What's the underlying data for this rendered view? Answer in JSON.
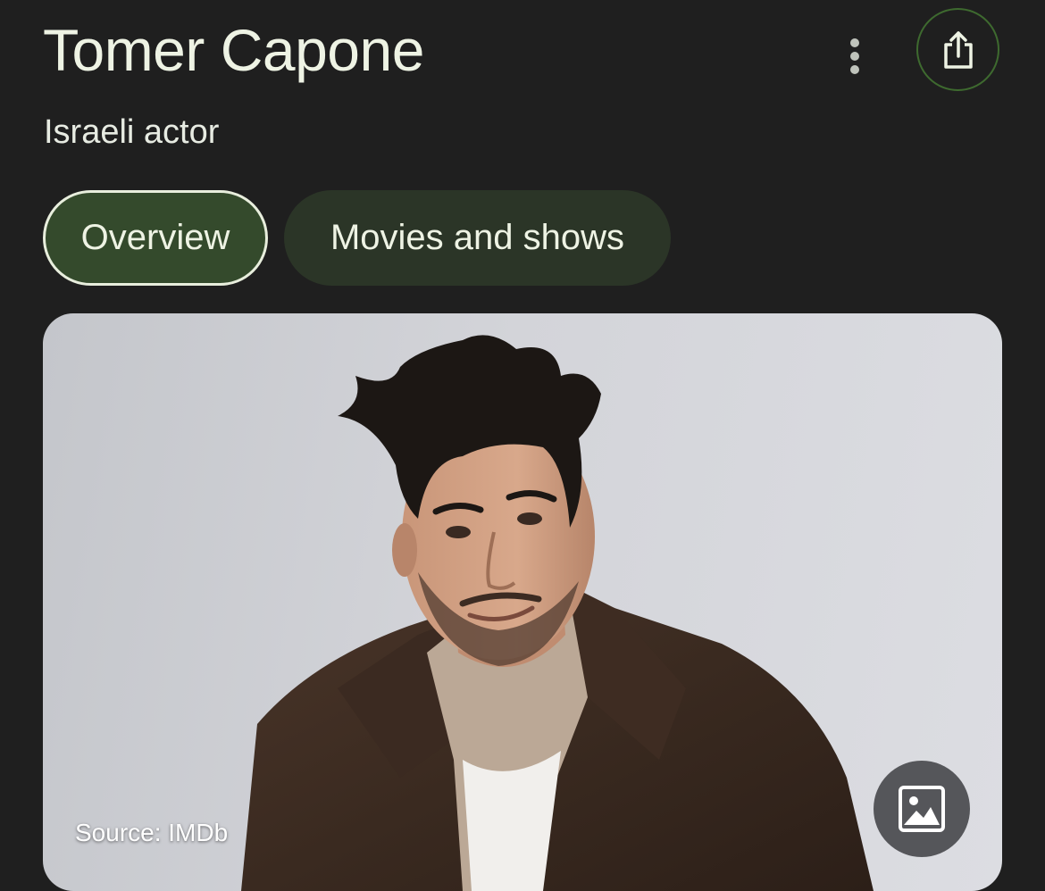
{
  "header": {
    "title": "Tomer Capone",
    "subtitle": "Israeli actor"
  },
  "actions": {
    "more_icon": "more-vertical-icon",
    "share_icon": "share-icon"
  },
  "tabs": [
    {
      "label": "Overview",
      "selected": true
    },
    {
      "label": "Movies and shows",
      "selected": false
    }
  ],
  "image": {
    "source": "Source: IMDb",
    "button_icon": "image-icon"
  },
  "colors": {
    "background": "#1f1f1f",
    "text": "#eef3e4",
    "tab_selected_bg": "#344a2c",
    "tab_bg": "#2b3527",
    "share_ring": "#3e6a2f"
  }
}
